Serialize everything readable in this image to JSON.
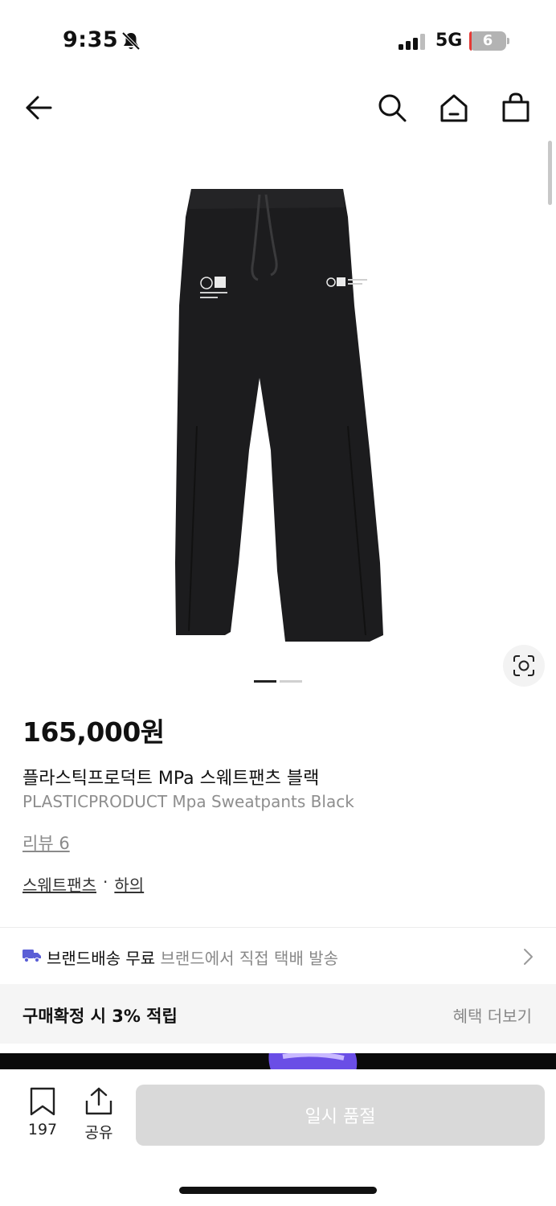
{
  "status_bar": {
    "time": "9:35",
    "network": "5G",
    "battery": "6",
    "battery_level": 0.06
  },
  "nav": {
    "icons": [
      "back-arrow-icon",
      "search-icon",
      "home-icon",
      "shopping-bag-icon"
    ]
  },
  "gallery": {
    "page_count": 2,
    "current_page": 1
  },
  "product": {
    "price": "165,000원",
    "name_ko": "플라스틱프로덕트 MPa 스웨트팬츠 블랙",
    "name_en": "PLASTICPRODUCT Mpa Sweatpants Black",
    "review_label": "리뷰 6",
    "category_primary": "스웨트팬츠",
    "category_separator": "·",
    "category_secondary": "하의"
  },
  "shipping": {
    "title": "브랜드배송 무료",
    "detail": "브랜드에서 직접 택배 발송"
  },
  "benefit": {
    "title": "구매확정 시 3% 적립",
    "more": "혜택 더보기"
  },
  "bottom_bar": {
    "bookmark_count": "197",
    "share_label": "공유",
    "action_label": "일시 품절"
  },
  "colors": {
    "pager_active": "#222222",
    "pager_inactive": "#d0d0d0",
    "truck": "#5b5fd6",
    "disabled_button": "#d9d9d9"
  }
}
